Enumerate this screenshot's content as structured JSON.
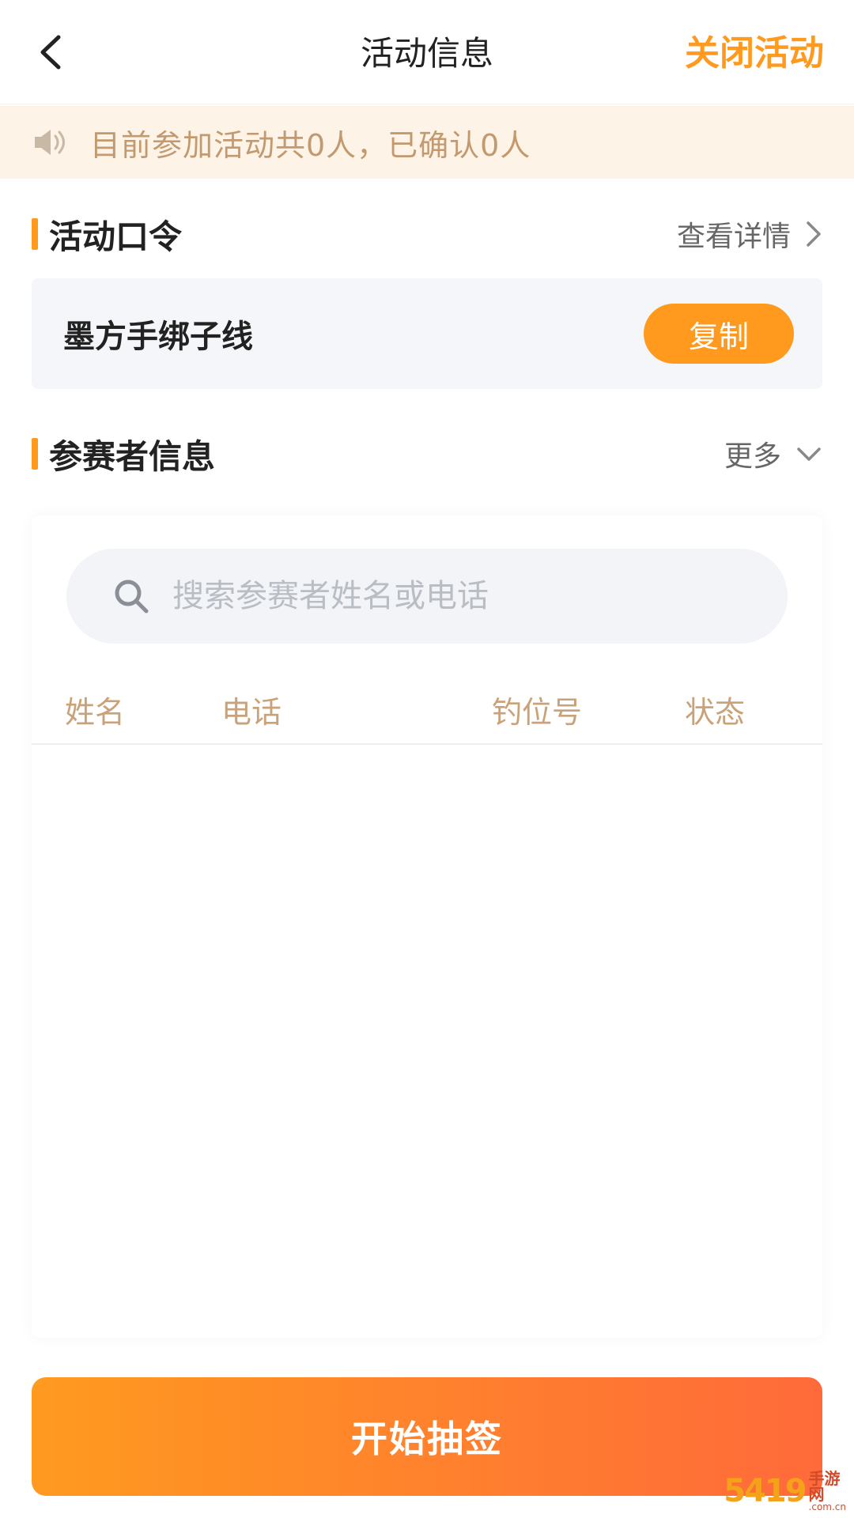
{
  "header": {
    "title": "活动信息",
    "close_label": "关闭活动"
  },
  "notice": {
    "text": "目前参加活动共0人，已确认0人",
    "icon": "speaker-icon"
  },
  "password_section": {
    "title": "活动口令",
    "action_label": "查看详情",
    "password": "墨方手绑子线",
    "copy_label": "复制"
  },
  "participants_section": {
    "title": "参赛者信息",
    "action_label": "更多",
    "search_placeholder": "搜索参赛者姓名或电话",
    "columns": [
      "姓名",
      "电话",
      "钓位号",
      "状态"
    ],
    "rows": []
  },
  "footer": {
    "start_label": "开始抽签"
  },
  "watermark": {
    "number": "5419",
    "top": "手游网",
    "bottom": ".com.cn"
  },
  "colors": {
    "accent": "#ff9a1f",
    "notice_bg": "#fdf3e7",
    "notice_text": "#c39a70",
    "column_header": "#c9a27a",
    "button_gradient_end": "#ff6a3a"
  }
}
